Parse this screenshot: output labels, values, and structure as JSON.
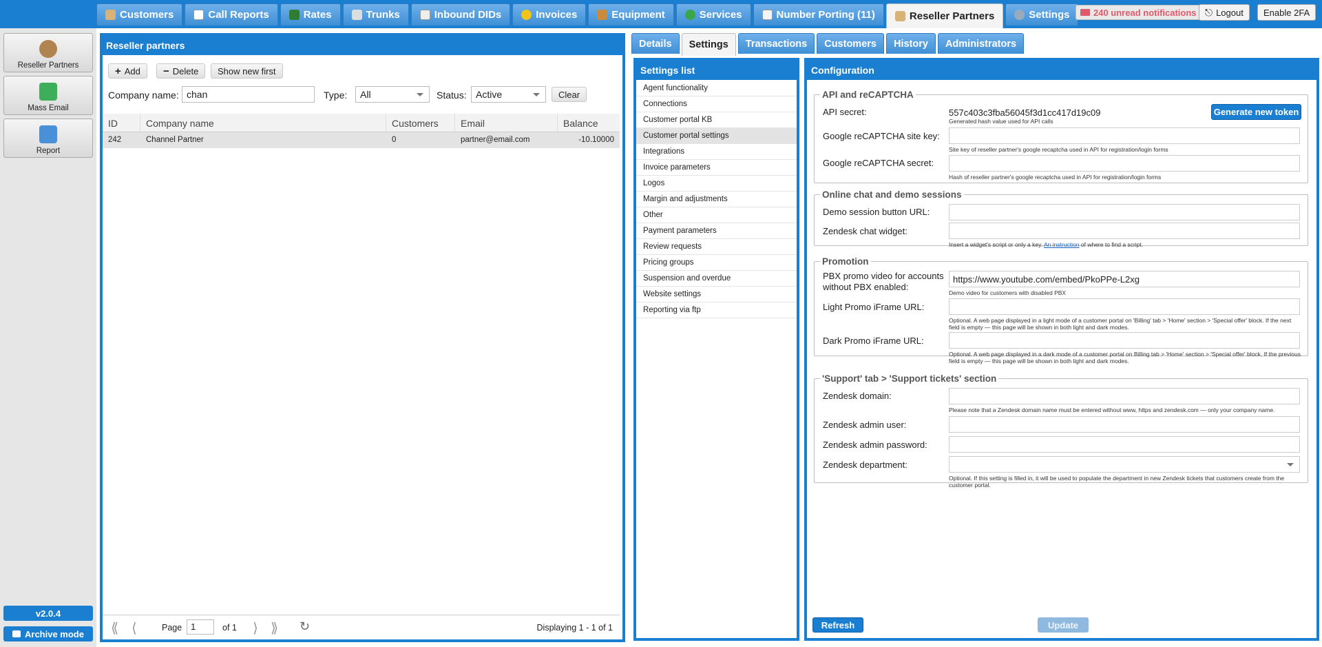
{
  "topnav": {
    "tabs": [
      {
        "label": "Customers",
        "icon": "person-icon"
      },
      {
        "label": "Call Reports",
        "icon": "report-icon"
      },
      {
        "label": "Rates",
        "icon": "rates-icon"
      },
      {
        "label": "Trunks",
        "icon": "trunk-icon"
      },
      {
        "label": "Inbound DIDs",
        "icon": "list-icon"
      },
      {
        "label": "Invoices",
        "icon": "coins-icon"
      },
      {
        "label": "Equipment",
        "icon": "box-icon"
      },
      {
        "label": "Services",
        "icon": "refresh-icon"
      },
      {
        "label": "Number Porting (11)",
        "icon": "phone-icon"
      },
      {
        "label": "Reseller Partners",
        "icon": "partner-icon"
      },
      {
        "label": "Settings",
        "icon": "gears-icon"
      }
    ],
    "notifications": "240 unread notifications",
    "logout": "Logout",
    "enable2fa": "Enable 2FA"
  },
  "sidebar": {
    "items": [
      {
        "label": "Reseller Partners"
      },
      {
        "label": "Mass Email"
      },
      {
        "label": "Report"
      }
    ],
    "version": "v2.0.4",
    "archive": "Archive mode"
  },
  "left": {
    "title": "Reseller partners",
    "add": "Add",
    "delete": "Delete",
    "show_new": "Show new first",
    "company_label": "Company name:",
    "company_value": "chan",
    "type_label": "Type:",
    "type_value": "All",
    "status_label": "Status:",
    "status_value": "Active",
    "clear": "Clear",
    "columns": [
      "ID",
      "Company name",
      "Customers",
      "Email",
      "Balance"
    ],
    "rows": [
      {
        "id": "242",
        "company": "Channel Partner",
        "customers": "0",
        "email": "partner@email.com",
        "balance": "-10.10000"
      }
    ],
    "pager": {
      "page_label": "Page",
      "page": "1",
      "of": "of 1",
      "display": "Displaying 1 - 1 of 1"
    }
  },
  "right": {
    "tabs": [
      "Details",
      "Settings",
      "Transactions",
      "Customers",
      "History",
      "Administrators"
    ],
    "settings_title": "Settings list",
    "settings_items": [
      "Agent functionality",
      "Connections",
      "Customer portal KB",
      "Customer portal settings",
      "Integrations",
      "Invoice parameters",
      "Logos",
      "Margin and adjustments",
      "Other",
      "Payment parameters",
      "Review requests",
      "Pricing groups",
      "Suspension and overdue",
      "Website settings",
      "Reporting via ftp"
    ],
    "config_title": "Configuration",
    "api": {
      "legend": "API and reCAPTCHA",
      "secret_label": "API secret:",
      "secret_value": "557c403c3fba56045f3d1cc417d19c09",
      "secret_help": "Generated hash value used for API calls",
      "generate": "Generate new token",
      "site_key_label": "Google reCAPTCHA site key:",
      "site_key_help": "Site key of reseller partner's google recaptcha used in API for registration/login forms",
      "secret2_label": "Google reCAPTCHA secret:",
      "secret2_help": "Hash of reseller partner's google recaptcha used in API for registration/login forms"
    },
    "chat": {
      "legend": "Online chat and demo sessions",
      "demo_label": "Demo session button URL:",
      "zendesk_label": "Zendesk chat widget:",
      "zendesk_help_pre": "Insert a widget's script or only a key.",
      "zendesk_help_link": "An instruction",
      "zendesk_help_post": "of where to find a script."
    },
    "promo": {
      "legend": "Promotion",
      "pbx_label1": "PBX promo video for accounts",
      "pbx_label2": "without PBX enabled:",
      "pbx_value": "https://www.youtube.com/embed/PkoPPe-L2xg",
      "pbx_help": "Demo video for customers with disabled PBX",
      "light_label": "Light Promo iFrame URL:",
      "light_help": "Optional. A web page displayed in a light mode of a customer portal on 'Billing' tab > 'Home' section > 'Special offer' block. If the next field is empty — this page will be shown in both light and dark modes.",
      "dark_label": "Dark Promo iFrame URL:",
      "dark_help": "Optional. A web page displayed in a dark mode of a customer portal on Billing tab > 'Home' section > 'Special offer' block. If the previous field is empty — this page will be shown in both light and dark modes."
    },
    "support": {
      "legend": "'Support' tab > 'Support tickets' section",
      "domain_label": "Zendesk domain:",
      "domain_help": "Please note that a Zendesk domain name must be entered without www, https and zendesk.com — only your company name.",
      "admin_label": "Zendesk admin user:",
      "pass_label": "Zendesk admin password:",
      "dept_label": "Zendesk department:",
      "dept_help": "Optional. If this setting is filled in, it will be used to populate the department in new Zendesk tickets that customers create from the customer portal."
    },
    "refresh": "Refresh",
    "update": "Update"
  }
}
